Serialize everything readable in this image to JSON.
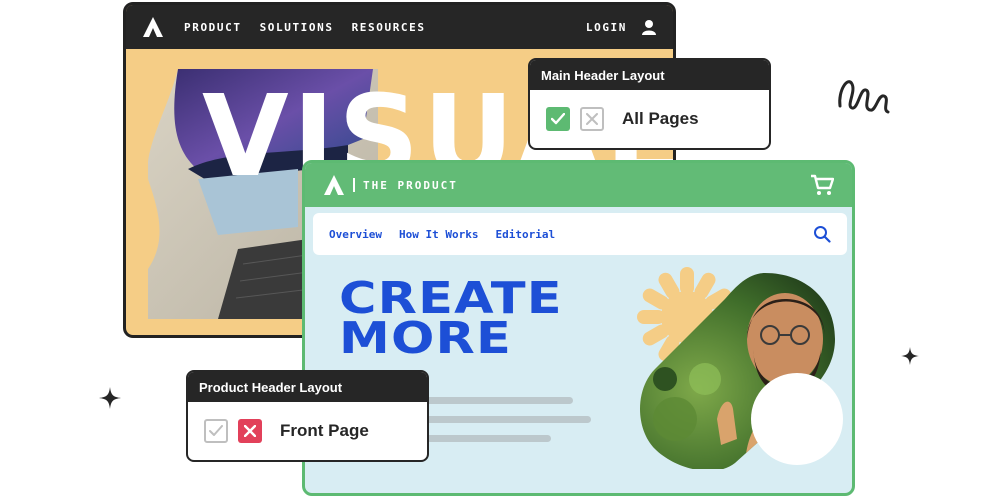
{
  "back_site": {
    "nav": [
      "PRODUCT",
      "SOLUTIONS",
      "RESOURCES"
    ],
    "login": "LOGIN",
    "hero_word": "VISUAL"
  },
  "front_site": {
    "title": "THE PRODUCT",
    "subnav": [
      "Overview",
      "How It Works",
      "Editorial"
    ],
    "hero_line1": "CREATE",
    "hero_line2": "MORE"
  },
  "main_header_card": {
    "title": "Main Header Layout",
    "option_label": "All Pages",
    "include_checked": true
  },
  "product_header_card": {
    "title": "Product Header Layout",
    "option_label": "Front Page",
    "exclude_checked": true
  },
  "colors": {
    "dark": "#262626",
    "green": "#62bb76",
    "blue": "#1d4fd6",
    "yellow": "#f5cd86",
    "red": "#e2405a",
    "light_blue": "#d8edf3"
  },
  "icons": [
    "logo-icon",
    "user-icon",
    "cart-icon",
    "search-icon",
    "check-icon",
    "close-icon",
    "sparkle-icon",
    "squiggle-icon"
  ]
}
